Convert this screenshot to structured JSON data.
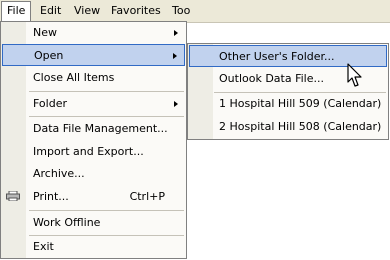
{
  "menubar": {
    "items": [
      "File",
      "Edit",
      "View",
      "Favorites",
      "Too"
    ]
  },
  "file_menu": {
    "new": "New",
    "open": "Open",
    "close_all": "Close All Items",
    "folder": "Folder",
    "data_file_management": "Data File Management...",
    "import_export": "Import and Export...",
    "archive": "Archive...",
    "print": "Print...",
    "print_shortcut": "Ctrl+P",
    "work_offline": "Work Offline",
    "exit": "Exit"
  },
  "open_submenu": {
    "other_users_folder": "Other User's Folder...",
    "outlook_data_file": "Outlook Data File...",
    "recent_1": "1 Hospital Hill 509 (Calendar)",
    "recent_2": "2 Hospital Hill 508 (Calendar)"
  }
}
